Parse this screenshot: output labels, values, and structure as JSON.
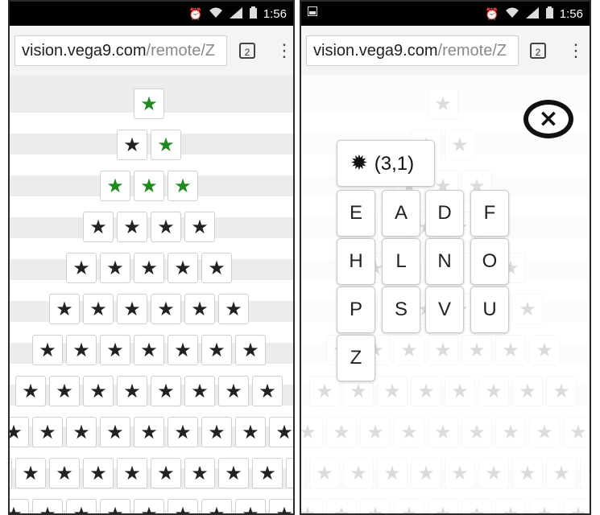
{
  "status": {
    "time": "1:56",
    "alarm_icon": "alarm-icon",
    "wifi_icon": "wifi-icon",
    "signal_icon": "signal-icon",
    "battery_icon": "battery-icon",
    "screenshot_icon": "image-icon"
  },
  "browser": {
    "url_domain": "vision.vega9.com",
    "url_path": "/remote/Z",
    "tab_count": "2"
  },
  "left_panel": {
    "star": "★",
    "green_color": "#1f8a1f"
  },
  "right_panel": {
    "popup_title": "(3,1)",
    "burst_icon": "burst-icon",
    "keys": [
      "E",
      "A",
      "D",
      "F",
      "H",
      "L",
      "N",
      "O",
      "P",
      "S",
      "V",
      "U",
      "Z"
    ],
    "close_label": "×"
  }
}
